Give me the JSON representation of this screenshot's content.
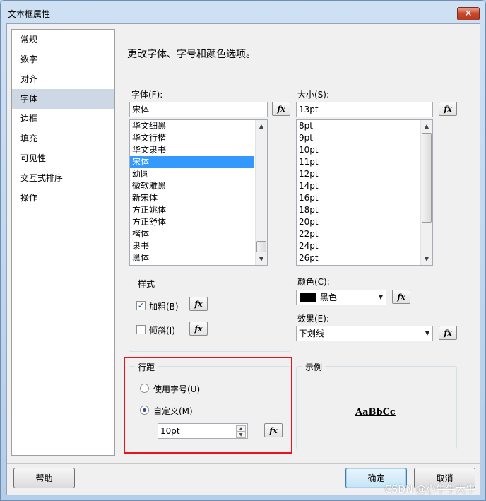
{
  "window": {
    "title": "文本框属性",
    "close_glyph": "✕"
  },
  "nav": {
    "items": [
      {
        "label": "常规",
        "selected": false
      },
      {
        "label": "数字",
        "selected": false
      },
      {
        "label": "对齐",
        "selected": false
      },
      {
        "label": "字体",
        "selected": true
      },
      {
        "label": "边框",
        "selected": false
      },
      {
        "label": "填充",
        "selected": false
      },
      {
        "label": "可见性",
        "selected": false
      },
      {
        "label": "交互式排序",
        "selected": false
      },
      {
        "label": "操作",
        "selected": false
      }
    ]
  },
  "heading": "更改字体、字号和颜色选项。",
  "font": {
    "label": "字体(F):",
    "value": "宋体",
    "list": [
      "华文细黑",
      "华文行楷",
      "华文隶书",
      "宋体",
      "幼圆",
      "微软雅黑",
      "新宋体",
      "方正姚体",
      "方正舒体",
      "楷体",
      "隶书",
      "黑体"
    ],
    "selected": "宋体"
  },
  "size": {
    "label": "大小(S):",
    "value": "13pt",
    "list": [
      "8pt",
      "9pt",
      "10pt",
      "11pt",
      "12pt",
      "14pt",
      "16pt",
      "18pt",
      "20pt",
      "22pt",
      "24pt",
      "26pt"
    ]
  },
  "style": {
    "title": "样式",
    "bold_label": "加粗(B)",
    "bold_checked": true,
    "italic_label": "倾斜(I)",
    "italic_checked": false
  },
  "color": {
    "label": "颜色(C):",
    "value": "黑色",
    "swatch": "#000000"
  },
  "effect": {
    "label": "效果(E):",
    "value": "下划线"
  },
  "spacing": {
    "title": "行距",
    "option_font": "使用字号(U)",
    "option_custom": "自定义(M)",
    "custom_selected": true,
    "custom_value": "10pt"
  },
  "sample": {
    "title": "示例",
    "text": "AaBbCc"
  },
  "fx_label": "fx",
  "buttons": {
    "help": "帮助",
    "ok": "确定",
    "cancel": "取消"
  },
  "watermark": "CSDN @小牛牛大牛",
  "colors": {
    "selection": "#3399ff",
    "highlight_box": "#e8141b",
    "nav_selected": "#cdd8e4"
  }
}
